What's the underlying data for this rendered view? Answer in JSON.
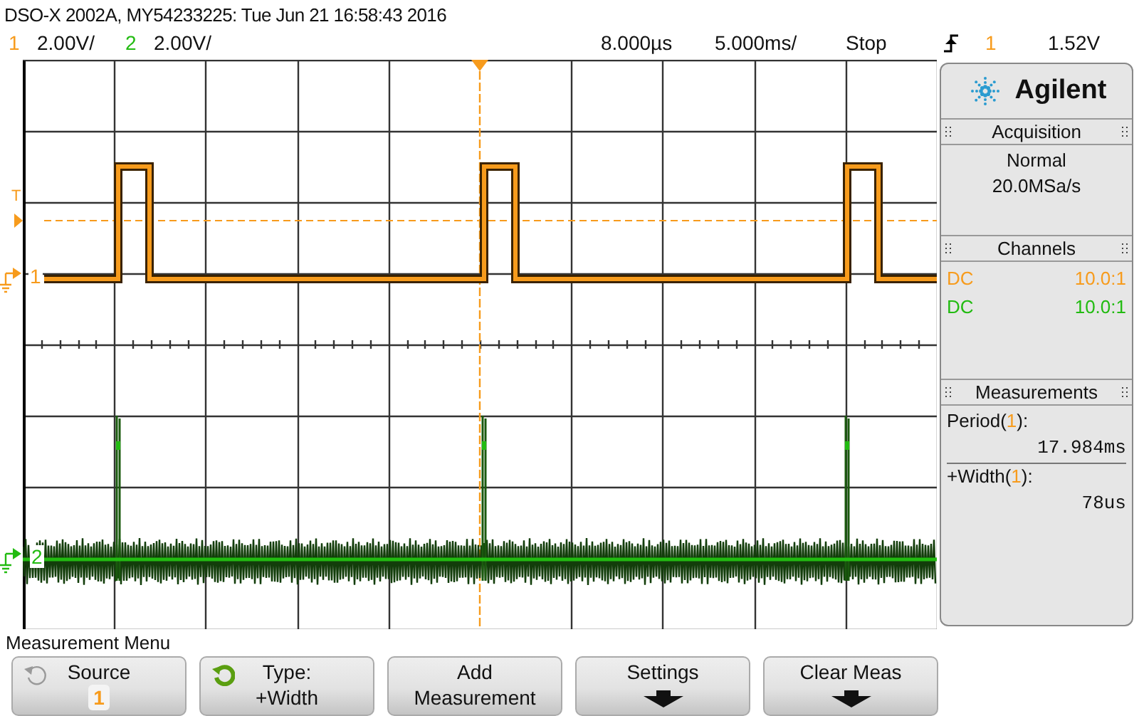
{
  "title": "DSO-X 2002A, MY54233225: Tue Jun 21 16:58:43 2016",
  "channels": [
    {
      "number": "1",
      "screen_label": "1",
      "color": "#f79b1c",
      "scale": "2.00V/",
      "coupling": "DC",
      "probe": "10.0:1"
    },
    {
      "number": "2",
      "screen_label": "2",
      "color": "#22bb11",
      "scale": "2.00V/",
      "coupling": "DC",
      "probe": "10.0:1"
    }
  ],
  "timebase": {
    "delay": "8.000µs",
    "scale": "5.000ms/"
  },
  "run_state": "Stop",
  "trigger": {
    "source": "1",
    "color": "#f79b1c",
    "level": "1.52V",
    "marker": "T"
  },
  "brand": "Agilent",
  "acquisition": {
    "heading": "Acquisition",
    "mode": "Normal",
    "rate": "20.0MSa/s"
  },
  "channels_heading": "Channels",
  "measurements": {
    "heading": "Measurements",
    "items": [
      {
        "prefix": "Period(",
        "source": "1",
        "suffix": "):",
        "color": "#f79b1c",
        "value": "17.984ms"
      },
      {
        "prefix": "+Width(",
        "source": "1",
        "suffix": "):",
        "color": "#f79b1c",
        "value": "78us"
      }
    ]
  },
  "menu": {
    "title": "Measurement Menu",
    "buttons": [
      {
        "kind": "knob",
        "enabled": false,
        "label": "Source",
        "value": "1",
        "color": "#f79b1c"
      },
      {
        "kind": "knob",
        "enabled": true,
        "label": "Type:",
        "value": "+Width"
      },
      {
        "kind": "plain",
        "label": "Add",
        "value": "Measurement"
      },
      {
        "kind": "submenu",
        "label": "Settings"
      },
      {
        "kind": "submenu",
        "label": "Clear Meas"
      }
    ]
  }
}
